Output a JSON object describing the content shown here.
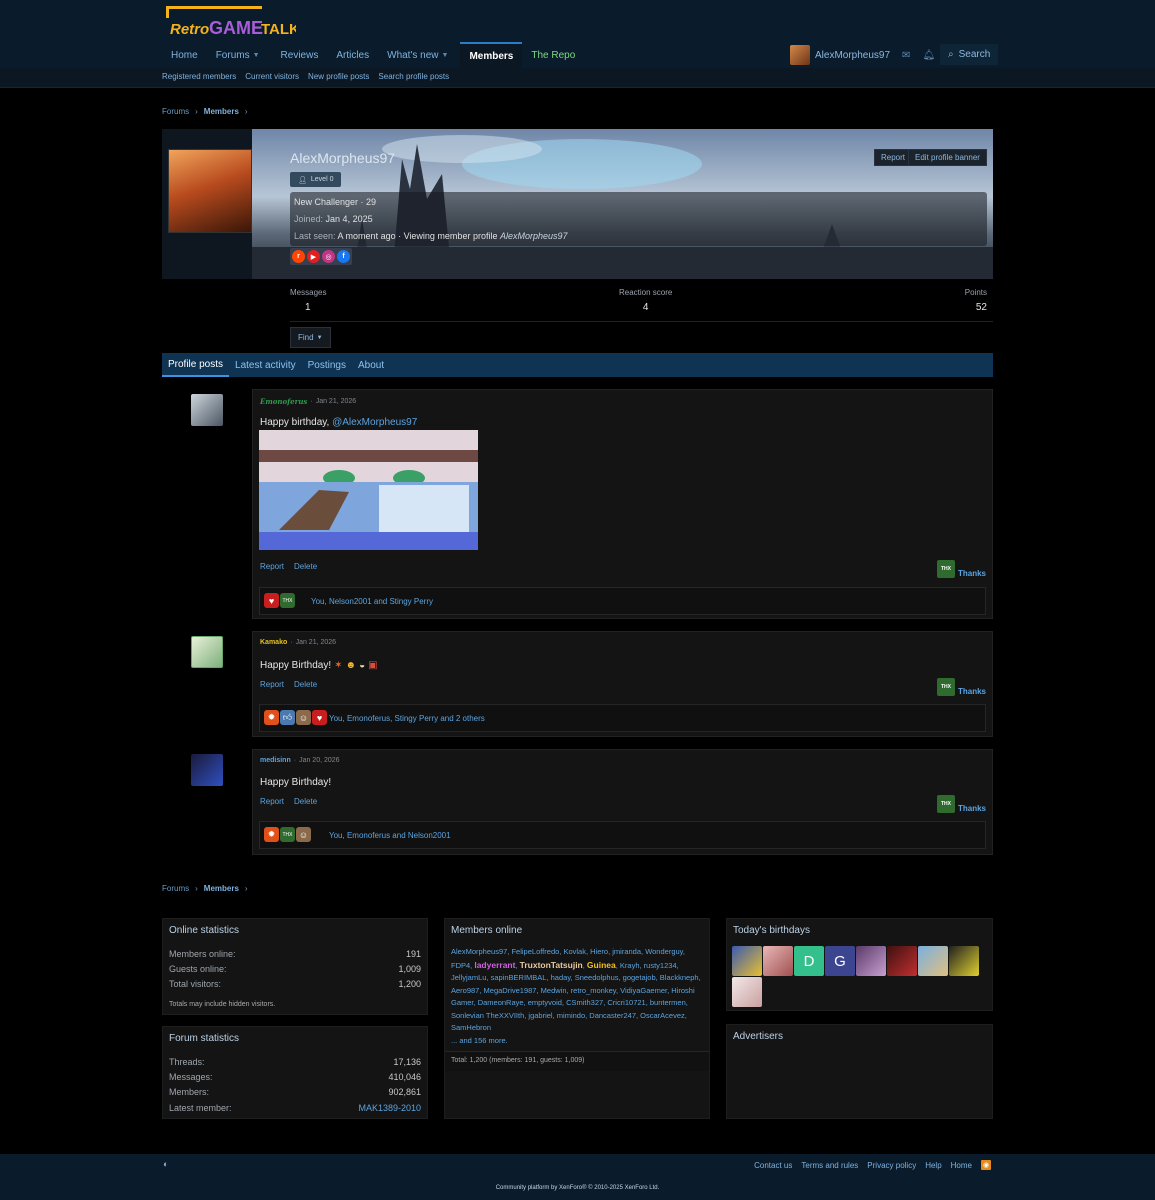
{
  "site": {
    "logo_text": "RetroGAMETALK"
  },
  "nav": {
    "tabs": [
      {
        "label": "Home"
      },
      {
        "label": "Forums"
      },
      {
        "label": "Reviews"
      },
      {
        "label": "Articles"
      },
      {
        "label": "What's new"
      },
      {
        "label": "Members"
      },
      {
        "label": "The Repo"
      }
    ],
    "user_name": "AlexMorpheus97",
    "search_label": "Search",
    "sub_items": [
      "Registered members",
      "Current visitors",
      "New profile posts",
      "Search profile posts"
    ]
  },
  "breadcrumb": {
    "root": "Forums",
    "current": "Members"
  },
  "profile": {
    "name": "AlexMorpheus97",
    "level": "Level 0",
    "title_line": "New Challenger · 29",
    "joined_label": "Joined:",
    "joined_value": "Jan 4, 2025",
    "last_seen_label": "Last seen:",
    "last_seen_value": "A moment ago · Viewing member profile",
    "last_seen_link": "AlexMorpheus97",
    "report_label": "Report",
    "edit_banner_label": "Edit profile banner",
    "stats": [
      {
        "label": "Messages",
        "value": "1"
      },
      {
        "label": "Reaction score",
        "value": "4"
      },
      {
        "label": "Points",
        "value": "52"
      }
    ],
    "find_label": "Find"
  },
  "profile_tabs": [
    "Profile posts",
    "Latest activity",
    "Postings",
    "About"
  ],
  "posts": [
    {
      "author": "Emonoferus",
      "date": "Jan 21, 2026",
      "text": "Happy birthday,",
      "mention": "@AlexMorpheus97",
      "report": "Report",
      "delete": "Delete",
      "thanks": "Thanks",
      "reactors": "You, Nelson2001 and Stingy Perry"
    },
    {
      "author": "Kamako",
      "date": "Jan 21, 2026",
      "text": "Happy Birthday!",
      "report": "Report",
      "delete": "Delete",
      "thanks": "Thanks",
      "reactors": "You, Emonoferus, Stingy Perry and 2 others"
    },
    {
      "author": "medisinn",
      "date": "Jan 20, 2026",
      "text": "Happy Birthday!",
      "report": "Report",
      "delete": "Delete",
      "thanks": "Thanks",
      "reactors": "You, Emonoferus and Nelson2001"
    }
  ],
  "online_stats": {
    "title": "Online statistics",
    "rows": [
      {
        "label": "Members online:",
        "value": "191"
      },
      {
        "label": "Guests online:",
        "value": "1,009"
      },
      {
        "label": "Total visitors:",
        "value": "1,200"
      }
    ],
    "note": "Totals may include hidden visitors."
  },
  "forum_stats": {
    "title": "Forum statistics",
    "rows": [
      {
        "label": "Threads:",
        "value": "17,136"
      },
      {
        "label": "Messages:",
        "value": "410,046"
      },
      {
        "label": "Members:",
        "value": "902,861"
      },
      {
        "label": "Latest member:",
        "value": "MAK1389-2010"
      }
    ]
  },
  "members_online": {
    "title": "Members online",
    "names": [
      "AlexMorpheus97",
      "FelipeLoffredo",
      "Kovlak",
      "Hiero",
      "jmiranda",
      "Wonderguy",
      "FDP4",
      "ladyerrant",
      "TruxtonTatsujin",
      "Guinea",
      "Krayh",
      "rusty1234",
      "JellyjamLu",
      "sapinBERIMBAL",
      "haday",
      "Sneedolphus",
      "gogetajob",
      "Blackkneph",
      "Aero987",
      "MegaDrive1987",
      "Medwin",
      "retro_monkey",
      "VidiyaGaemer",
      "Hiroshi Gamer",
      "DameonRaye",
      "emptyvoid",
      "CSmith327",
      "Cricri10721",
      "buntermen",
      "Sonlevian TheXXVIIth",
      "jgabriel",
      "mimindo",
      "Dancaster247",
      "OscarAcevez",
      "SamHebron"
    ],
    "more": "... and 156 more.",
    "total": "Total: 1,200 (members: 191, guests: 1,009)"
  },
  "birthdays": {
    "title": "Today's birthdays",
    "letters": [
      "D",
      "G"
    ]
  },
  "advertisers": {
    "title": "Advertisers"
  },
  "footer": {
    "links": [
      "Contact us",
      "Terms and rules",
      "Privacy policy",
      "Help",
      "Home"
    ],
    "copyright": "Community platform by XenForo® © 2010-2025 XenForo Ltd."
  },
  "colors": {
    "header_bg": "#0a1c2c",
    "accent": "#5ba4e0",
    "tab_bar": "#0f3352"
  }
}
